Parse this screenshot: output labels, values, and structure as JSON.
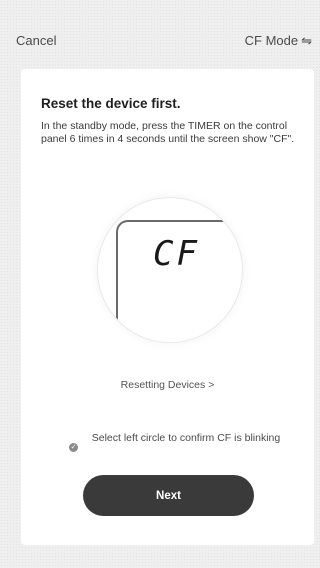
{
  "header": {
    "cancel_label": "Cancel",
    "mode_label": "CF Mode",
    "mode_icon": "⇋"
  },
  "card": {
    "title": "Reset the device first.",
    "instructions": "In the standby mode, press the TIMER on the control panel 6 times in 4 seconds until the screen show \"CF\".",
    "display_text": "CF",
    "resetting_link": "Resetting Devices >",
    "confirm_text": "Select left circle to confirm CF is blinking",
    "checkbox_icon": "✓",
    "next_label": "Next"
  },
  "colors": {
    "background": "#efefef",
    "card": "#ffffff",
    "button": "#3a3a3a",
    "button_text": "#ffffff"
  }
}
